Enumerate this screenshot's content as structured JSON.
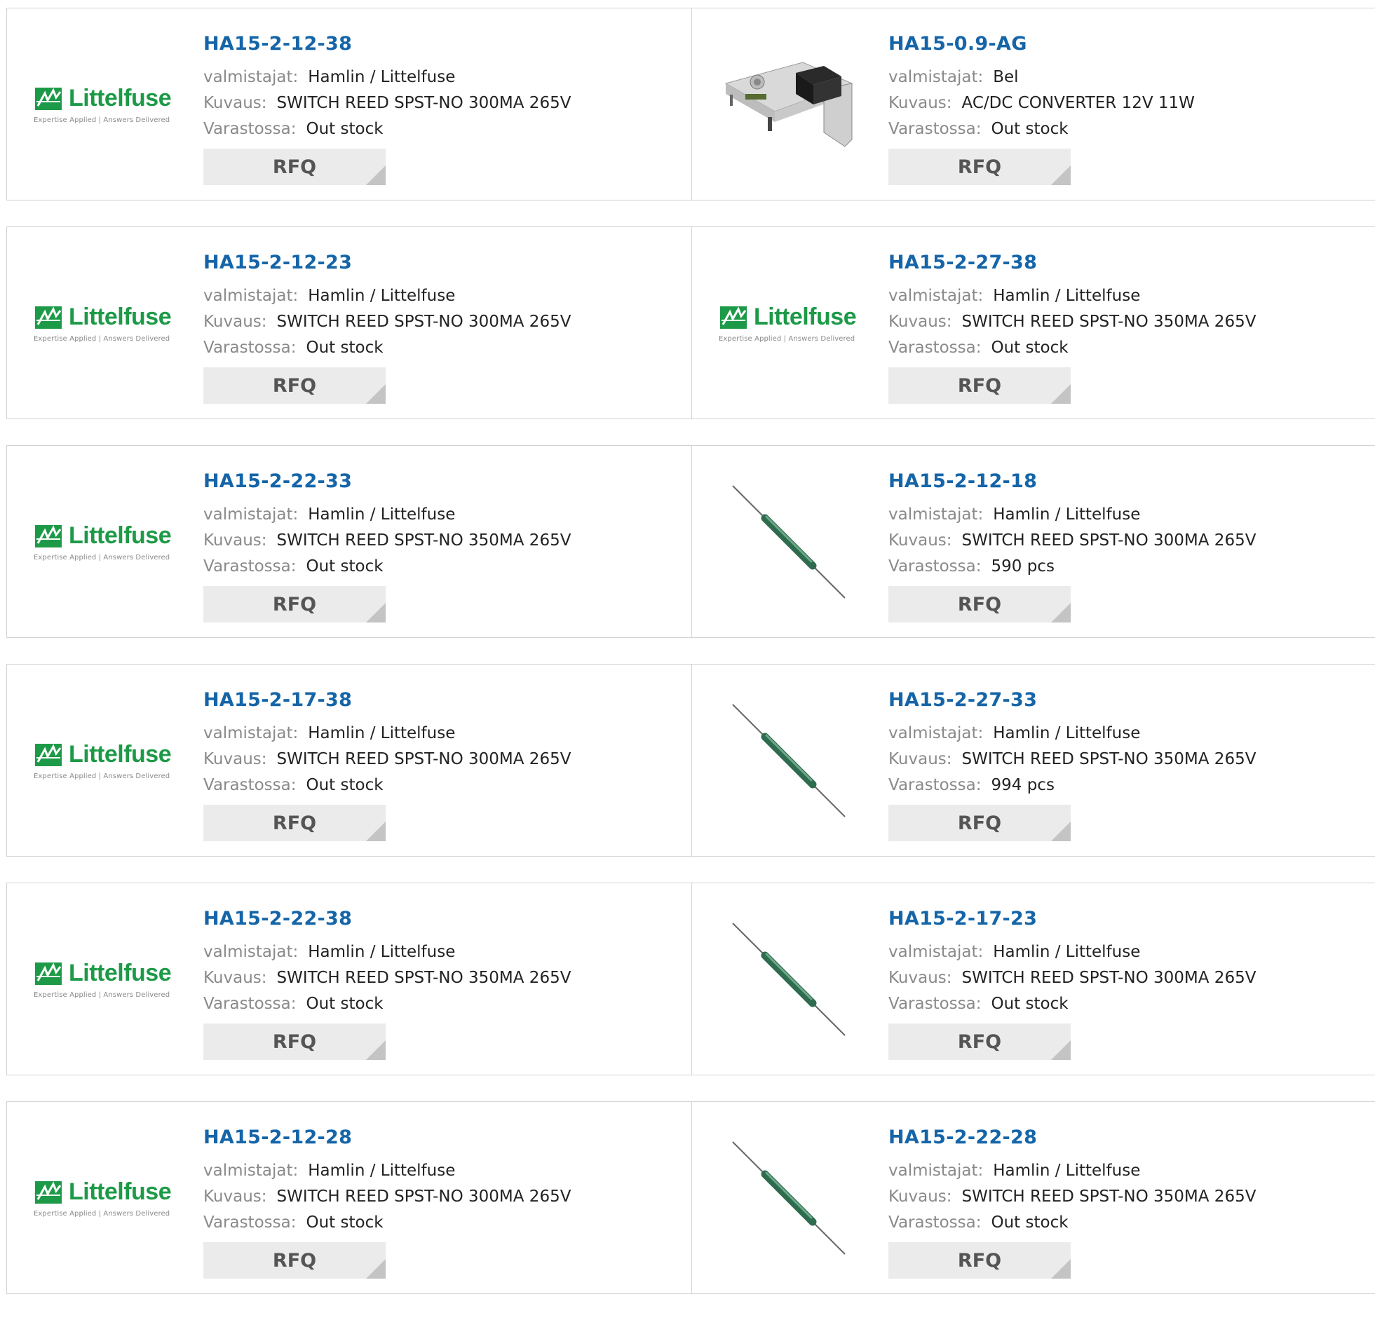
{
  "labels": {
    "manufacturer": "valmistajat:",
    "description": "Kuvaus:",
    "stock": "Varastossa:",
    "rfq": "RFQ"
  },
  "logo": {
    "brand": "Littelfuse",
    "tagline": "Expertise Applied | Answers Delivered",
    "color": "#1d9a47"
  },
  "colors": {
    "part_link": "#1565a8",
    "label": "#8a8a8a",
    "rfq_bg": "#ebebeb"
  },
  "products": [
    {
      "part": "HA15-2-12-38",
      "image": "littelfuse-logo",
      "manufacturer": "Hamlin / Littelfuse",
      "description": "SWITCH REED SPST-NO 300MA 265V",
      "stock": "Out stock"
    },
    {
      "part": "HA15-0.9-AG",
      "image": "power-supply-photo",
      "manufacturer": "Bel",
      "description": "AC/DC CONVERTER 12V 11W",
      "stock": "Out stock"
    },
    {
      "part": "HA15-2-12-23",
      "image": "littelfuse-logo",
      "manufacturer": "Hamlin / Littelfuse",
      "description": "SWITCH REED SPST-NO 300MA 265V",
      "stock": "Out stock"
    },
    {
      "part": "HA15-2-27-38",
      "image": "littelfuse-logo",
      "manufacturer": "Hamlin / Littelfuse",
      "description": "SWITCH REED SPST-NO 350MA 265V",
      "stock": "Out stock"
    },
    {
      "part": "HA15-2-22-33",
      "image": "littelfuse-logo",
      "manufacturer": "Hamlin / Littelfuse",
      "description": "SWITCH REED SPST-NO 350MA 265V",
      "stock": "Out stock"
    },
    {
      "part": "HA15-2-12-18",
      "image": "reed-switch-photo",
      "manufacturer": "Hamlin / Littelfuse",
      "description": "SWITCH REED SPST-NO 300MA 265V",
      "stock": "590 pcs"
    },
    {
      "part": "HA15-2-17-38",
      "image": "littelfuse-logo",
      "manufacturer": "Hamlin / Littelfuse",
      "description": "SWITCH REED SPST-NO 300MA 265V",
      "stock": "Out stock"
    },
    {
      "part": "HA15-2-27-33",
      "image": "reed-switch-photo",
      "manufacturer": "Hamlin / Littelfuse",
      "description": "SWITCH REED SPST-NO 350MA 265V",
      "stock": "994 pcs"
    },
    {
      "part": "HA15-2-22-38",
      "image": "littelfuse-logo",
      "manufacturer": "Hamlin / Littelfuse",
      "description": "SWITCH REED SPST-NO 350MA 265V",
      "stock": "Out stock"
    },
    {
      "part": "HA15-2-17-23",
      "image": "reed-switch-photo",
      "manufacturer": "Hamlin / Littelfuse",
      "description": "SWITCH REED SPST-NO 300MA 265V",
      "stock": "Out stock"
    },
    {
      "part": "HA15-2-12-28",
      "image": "littelfuse-logo",
      "manufacturer": "Hamlin / Littelfuse",
      "description": "SWITCH REED SPST-NO 300MA 265V",
      "stock": "Out stock"
    },
    {
      "part": "HA15-2-22-28",
      "image": "reed-switch-photo",
      "manufacturer": "Hamlin / Littelfuse",
      "description": "SWITCH REED SPST-NO 350MA 265V",
      "stock": "Out stock"
    }
  ]
}
